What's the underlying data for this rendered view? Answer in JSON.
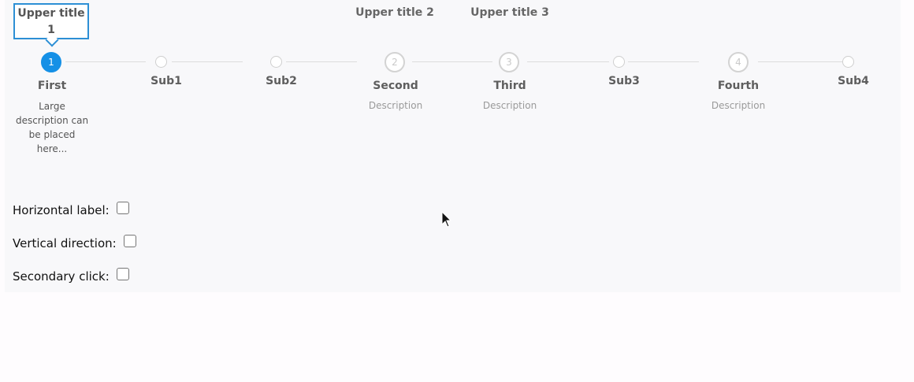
{
  "steps": [
    {
      "kind": "major",
      "number": "1",
      "label": "First",
      "description": "Large description can be placed here...",
      "upper_title": "Upper title 1",
      "active": true
    },
    {
      "kind": "minor",
      "label": "Sub1"
    },
    {
      "kind": "minor",
      "label": "Sub2"
    },
    {
      "kind": "major",
      "number": "2",
      "label": "Second",
      "description": "Description",
      "upper_title": "Upper title 2",
      "active": false
    },
    {
      "kind": "major",
      "number": "3",
      "label": "Third",
      "description": "Description",
      "upper_title": "Upper title 3",
      "active": false
    },
    {
      "kind": "minor",
      "label": "Sub3"
    },
    {
      "kind": "major",
      "number": "4",
      "label": "Fourth",
      "description": "Description",
      "active": false
    },
    {
      "kind": "minor",
      "label": "Sub4"
    }
  ],
  "options": {
    "horizontal_label": {
      "label": "Horizontal label:",
      "checked": false
    },
    "vertical_direction": {
      "label": "Vertical direction:",
      "checked": false
    },
    "secondary_click": {
      "label": "Secondary click:",
      "checked": false
    }
  },
  "colors": {
    "active": "#1590e6",
    "accent_border": "#2d8fd5",
    "connector": "#dcdcdc"
  }
}
